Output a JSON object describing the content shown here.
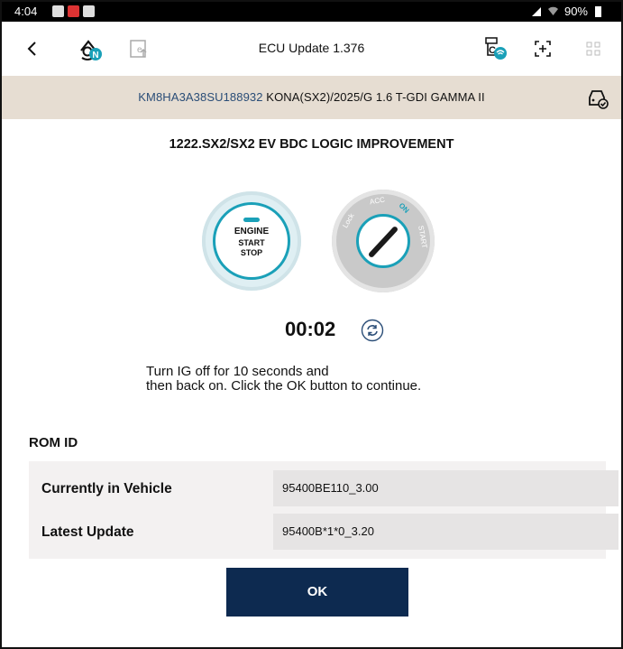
{
  "status_bar": {
    "time": "4:04",
    "battery": "90%"
  },
  "app_bar": {
    "title": "ECU Update 1.376",
    "badge": "N",
    "icons": [
      "back-icon",
      "remote-service-icon",
      "export-icon",
      "cloud-sync-icon",
      "scan-icon",
      "grid-icon"
    ]
  },
  "vehicle": {
    "vin": "KM8HA3A38SU188932",
    "description": "KONA(SX2)/2025/G 1.6 T-GDI GAMMA II"
  },
  "update_title": "1222.SX2/SX2 EV BDC LOGIC IMPROVEMENT",
  "engine_button": {
    "line1": "ENGINE",
    "line2": "START",
    "line3": "STOP"
  },
  "ignition": {
    "lock": "Lock",
    "acc": "ACC",
    "on": "ON",
    "start": "START"
  },
  "timer": "00:02",
  "instructions": {
    "line1": "Turn IG off for 10 seconds and",
    "line2": "then back on. Click the OK button to continue."
  },
  "rom": {
    "heading": "ROM ID",
    "rows": [
      {
        "label": "Currently in Vehicle",
        "value": "95400BE110_3.00"
      },
      {
        "label": "Latest Update",
        "value": "95400B*1*0_3.20"
      }
    ]
  },
  "ok_label": "OK",
  "colors": {
    "accent": "#1aa0b8",
    "primary_button": "#0d2a50",
    "vehicle_bar": "#e6ddd2",
    "vin_text": "#2a4d77"
  }
}
